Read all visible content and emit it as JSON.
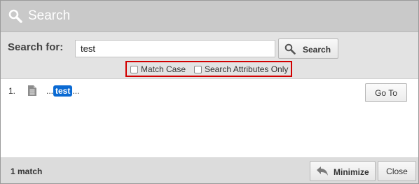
{
  "dialog": {
    "title": "Search",
    "title_icon": "search-icon"
  },
  "search": {
    "label": "Search for:",
    "value": "test",
    "button_label": "Search",
    "button_icon": "search-icon",
    "options": [
      {
        "label": "Match Case",
        "checked": false
      },
      {
        "label": "Search Attributes Only",
        "checked": false
      }
    ],
    "options_highlight_color": "#d10000"
  },
  "results": {
    "items": [
      {
        "number": "1.",
        "icon": "document-icon",
        "prefix": "...",
        "match": "test",
        "suffix": "...",
        "action_label": "Go To"
      }
    ],
    "highlight_color": "#0a6ad3"
  },
  "footer": {
    "match_count": "1 match",
    "minimize_label": "Minimize",
    "minimize_icon": "undo-arrow-icon",
    "close_label": "Close"
  }
}
